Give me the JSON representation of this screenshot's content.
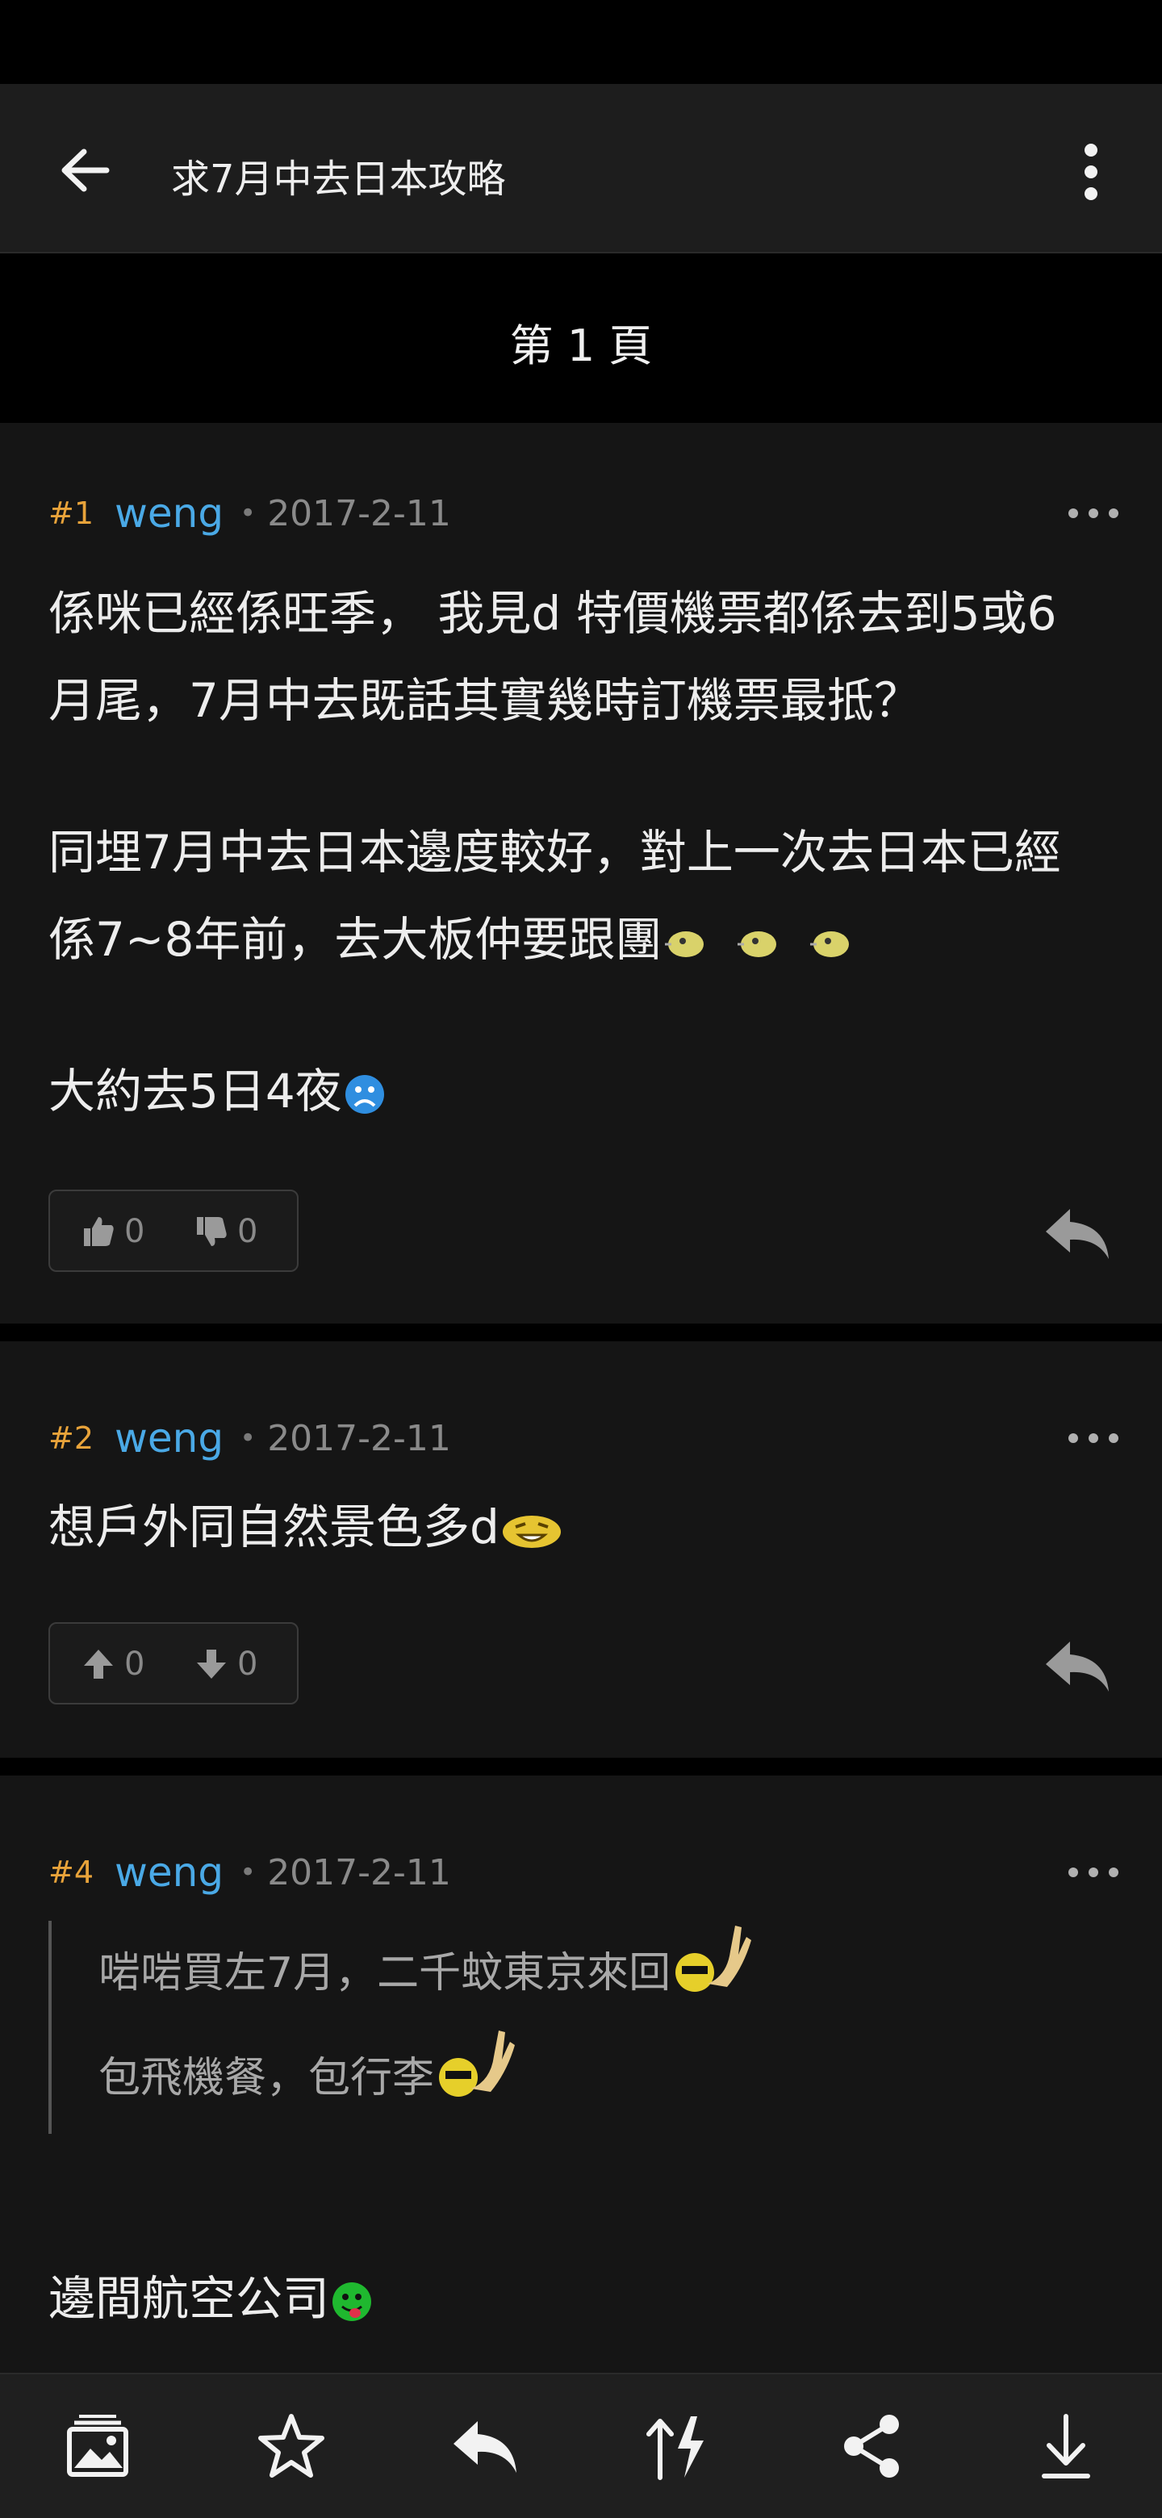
{
  "header": {
    "title": "求7月中去日本攻略"
  },
  "page_indicator": "第 1 頁",
  "posts": [
    {
      "num": "#1",
      "user": "weng",
      "date": "2017-2-11",
      "paragraphs": [
        "係咪已經係旺季， 我見d 特價機票都係去到5或6月尾，7月中去既話其實幾時訂機票最抵？",
        "同埋7月中去日本邊度較好，對上一次去日本已經係7~8年前，去大板仲要跟團",
        "大約去5日4夜"
      ],
      "likes": "0",
      "dislikes": "0"
    },
    {
      "num": "#2",
      "user": "weng",
      "date": "2017-2-11",
      "paragraphs": [
        "想戶外同自然景色多d"
      ],
      "likes": "0",
      "dislikes": "0"
    },
    {
      "num": "#4",
      "user": "weng",
      "date": "2017-2-11",
      "quote": [
        "啱啱買左7月，二千蚊東京來回",
        "包飛機餐，包行李"
      ],
      "paragraphs": [
        "邊間航空公司"
      ]
    }
  ],
  "icons": {
    "back": "back-arrow-icon",
    "more": "more-vertical-icon",
    "post_more": "more-horizontal-icon",
    "like": "thumbs-up-icon",
    "dislike": "thumbs-down-icon",
    "upvote": "arrow-up-icon",
    "downvote": "arrow-down-icon",
    "reply": "reply-icon",
    "gallery": "image-gallery-icon",
    "star": "star-icon",
    "sort": "sort-arrows-icon",
    "share": "share-icon",
    "download": "scroll-to-bottom-icon"
  },
  "colors": {
    "background": "#000000",
    "card": "#151515",
    "appbar": "#1d1d1d",
    "post_number": "#e8a33a",
    "username": "#4aa9e6",
    "meta": "#8a8a8a"
  }
}
